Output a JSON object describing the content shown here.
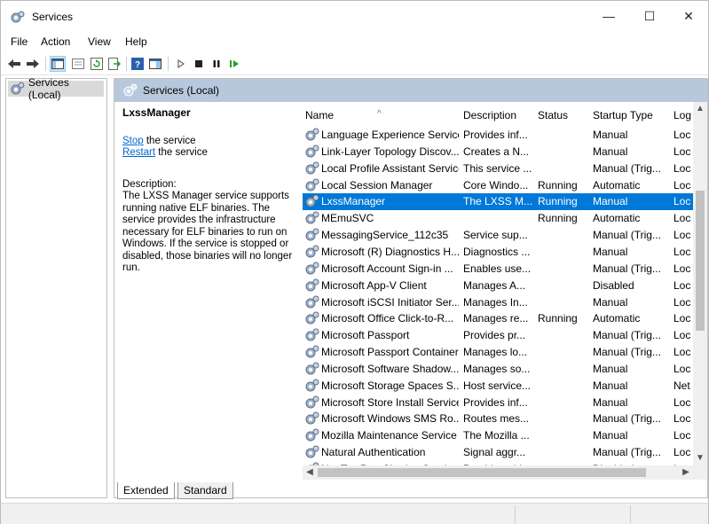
{
  "window": {
    "title": "Services",
    "minimize": "—",
    "maximize": "☐",
    "close": "✕"
  },
  "menu": [
    "File",
    "Action",
    "View",
    "Help"
  ],
  "tree": {
    "root": "Services (Local)"
  },
  "pane": {
    "header": "Services (Local)"
  },
  "detail": {
    "service_name": "LxssManager",
    "stop_link": "Stop",
    "stop_suffix": " the service",
    "restart_link": "Restart",
    "restart_suffix": " the service",
    "description_label": "Description:",
    "description": "The LXSS Manager service supports running native ELF binaries. The service provides the infrastructure necessary for ELF binaries to run on Windows. If the service is stopped or disabled, those binaries will no longer run."
  },
  "columns": {
    "name": "Name",
    "description": "Description",
    "status": "Status",
    "startup_type": "Startup Type",
    "log_on_as": "Log"
  },
  "sort_indicator": "^",
  "services": [
    {
      "name": "Language Experience Service",
      "description": "Provides inf...",
      "status": "",
      "startup_type": "Manual",
      "log_on_as": "Loc"
    },
    {
      "name": "Link-Layer Topology Discov...",
      "description": "Creates a N...",
      "status": "",
      "startup_type": "Manual",
      "log_on_as": "Loc"
    },
    {
      "name": "Local Profile Assistant Service",
      "description": "This service ...",
      "status": "",
      "startup_type": "Manual (Trig...",
      "log_on_as": "Loc"
    },
    {
      "name": "Local Session Manager",
      "description": "Core Windo...",
      "status": "Running",
      "startup_type": "Automatic",
      "log_on_as": "Loc"
    },
    {
      "name": "LxssManager",
      "description": "The LXSS M...",
      "status": "Running",
      "startup_type": "Manual",
      "log_on_as": "Loc",
      "selected": true
    },
    {
      "name": "MEmuSVC",
      "description": "",
      "status": "Running",
      "startup_type": "Automatic",
      "log_on_as": "Loc"
    },
    {
      "name": "MessagingService_112c35",
      "description": "Service sup...",
      "status": "",
      "startup_type": "Manual (Trig...",
      "log_on_as": "Loc"
    },
    {
      "name": "Microsoft (R) Diagnostics H...",
      "description": "Diagnostics ...",
      "status": "",
      "startup_type": "Manual",
      "log_on_as": "Loc"
    },
    {
      "name": "Microsoft Account Sign-in ...",
      "description": "Enables use...",
      "status": "",
      "startup_type": "Manual (Trig...",
      "log_on_as": "Loc"
    },
    {
      "name": "Microsoft App-V Client",
      "description": "Manages A...",
      "status": "",
      "startup_type": "Disabled",
      "log_on_as": "Loc"
    },
    {
      "name": "Microsoft iSCSI Initiator Ser...",
      "description": "Manages In...",
      "status": "",
      "startup_type": "Manual",
      "log_on_as": "Loc"
    },
    {
      "name": "Microsoft Office Click-to-R...",
      "description": "Manages re...",
      "status": "Running",
      "startup_type": "Automatic",
      "log_on_as": "Loc"
    },
    {
      "name": "Microsoft Passport",
      "description": "Provides pr...",
      "status": "",
      "startup_type": "Manual (Trig...",
      "log_on_as": "Loc"
    },
    {
      "name": "Microsoft Passport Container",
      "description": "Manages lo...",
      "status": "",
      "startup_type": "Manual (Trig...",
      "log_on_as": "Loc"
    },
    {
      "name": "Microsoft Software Shadow...",
      "description": "Manages so...",
      "status": "",
      "startup_type": "Manual",
      "log_on_as": "Loc"
    },
    {
      "name": "Microsoft Storage Spaces S...",
      "description": "Host service...",
      "status": "",
      "startup_type": "Manual",
      "log_on_as": "Net"
    },
    {
      "name": "Microsoft Store Install Service",
      "description": "Provides inf...",
      "status": "",
      "startup_type": "Manual",
      "log_on_as": "Loc"
    },
    {
      "name": "Microsoft Windows SMS Ro...",
      "description": "Routes mes...",
      "status": "",
      "startup_type": "Manual (Trig...",
      "log_on_as": "Loc"
    },
    {
      "name": "Mozilla Maintenance Service",
      "description": "The Mozilla ...",
      "status": "",
      "startup_type": "Manual",
      "log_on_as": "Loc"
    },
    {
      "name": "Natural Authentication",
      "description": "Signal aggr...",
      "status": "",
      "startup_type": "Manual (Trig...",
      "log_on_as": "Loc"
    },
    {
      "name": "Net.Tcp Port Sharing Service",
      "description": "Provides abi...",
      "status": "",
      "startup_type": "Disabled",
      "log_on_as": "Loc"
    }
  ],
  "tabs": [
    "Extended",
    "Standard"
  ],
  "colors": {
    "selection": "#0078d7",
    "pane_header": "#b8c8dc",
    "link": "#0066cc",
    "play_green": "#2a9d2a"
  },
  "icons": {
    "toolbar": [
      "back-arrow-icon",
      "forward-arrow-icon",
      "console-tree-icon",
      "properties-icon",
      "refresh-icon",
      "export-list-icon",
      "help-icon",
      "show-hide-icon",
      "start-service-icon",
      "stop-service-icon",
      "pause-service-icon",
      "resume-service-icon"
    ],
    "service": "gear-service-icon"
  }
}
